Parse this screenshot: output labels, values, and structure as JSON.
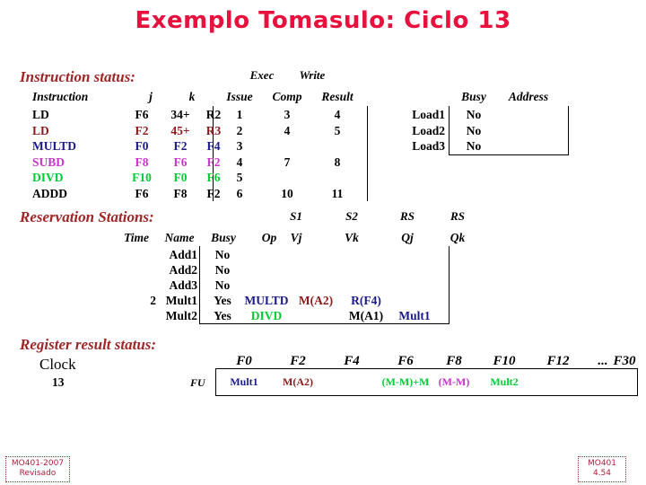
{
  "slide": {
    "title": "Exemplo Tomasulo: Ciclo 13",
    "title_color": "#e8103c"
  },
  "colors": {
    "black": "#000000",
    "red": "#8b1a1a",
    "blue": "#1a1a8b",
    "magenta": "#cc33cc",
    "green": "#00cc33",
    "caption": "#9e2626",
    "footer": "#b01c3c"
  },
  "instruction_status": {
    "caption": "Instruction status:",
    "group_headers": {
      "exec": "Exec",
      "write": "Write"
    },
    "headers": {
      "instruction": "Instruction",
      "j": "j",
      "k": "k",
      "issue": "Issue",
      "comp": "Comp",
      "result": "Result"
    },
    "rows": [
      {
        "instruction": "LD",
        "j": "F6",
        "k": "34+",
        "k2": "R2",
        "issue": "1",
        "comp": "3",
        "result": "4",
        "color": "#000000"
      },
      {
        "instruction": "LD",
        "j": "F2",
        "k": "45+",
        "k2": "R3",
        "issue": "2",
        "comp": "4",
        "result": "5",
        "color": "#8b1a1a"
      },
      {
        "instruction": "MULTD",
        "j": "F0",
        "k": "F2",
        "k2": "F4",
        "issue": "3",
        "comp": "",
        "result": "",
        "color": "#1a1a8b"
      },
      {
        "instruction": "SUBD",
        "j": "F8",
        "k": "F6",
        "k2": "F2",
        "issue": "4",
        "comp": "7",
        "result": "8",
        "color": "#cc33cc"
      },
      {
        "instruction": "DIVD",
        "j": "F10",
        "k": "F0",
        "k2": "F6",
        "issue": "5",
        "comp": "",
        "result": "",
        "color": "#00cc33"
      },
      {
        "instruction": "ADDD",
        "j": "F6",
        "k": "F8",
        "k2": "F2",
        "issue": "6",
        "comp": "10",
        "result": "11",
        "color": "#000000"
      }
    ]
  },
  "load_buffers": {
    "headers": {
      "busy": "Busy",
      "address": "Address"
    },
    "rows": [
      {
        "name": "Load1",
        "busy": "No",
        "address": ""
      },
      {
        "name": "Load2",
        "busy": "No",
        "address": ""
      },
      {
        "name": "Load3",
        "busy": "No",
        "address": ""
      }
    ]
  },
  "reservation_stations": {
    "caption": "Reservation Stations:",
    "group_headers": {
      "s1": "S1",
      "s2": "S2",
      "rs_j": "RS",
      "rs_k": "RS"
    },
    "headers": {
      "time": "Time",
      "name": "Name",
      "busy": "Busy",
      "op": "Op",
      "vj": "Vj",
      "vk": "Vk",
      "qj": "Qj",
      "qk": "Qk"
    },
    "rows": [
      {
        "time": "",
        "name": "Add1",
        "busy": "No",
        "op": "",
        "op_color": "#000000",
        "vj": "",
        "vj_color": "#000000",
        "vk": "",
        "vk_color": "#000000",
        "qj": "",
        "qj_color": "#000000",
        "qk": ""
      },
      {
        "time": "",
        "name": "Add2",
        "busy": "No",
        "op": "",
        "op_color": "#000000",
        "vj": "",
        "vj_color": "#000000",
        "vk": "",
        "vk_color": "#000000",
        "qj": "",
        "qj_color": "#000000",
        "qk": ""
      },
      {
        "time": "",
        "name": "Add3",
        "busy": "No",
        "op": "",
        "op_color": "#000000",
        "vj": "",
        "vj_color": "#000000",
        "vk": "",
        "vk_color": "#000000",
        "qj": "",
        "qj_color": "#000000",
        "qk": ""
      },
      {
        "time": "2",
        "name": "Mult1",
        "busy": "Yes",
        "op": "MULTD",
        "op_color": "#1a1a8b",
        "vj": "M(A2)",
        "vj_color": "#8b1a1a",
        "vk": "R(F4)",
        "vk_color": "#1a1a8b",
        "qj": "",
        "qj_color": "#000000",
        "qk": ""
      },
      {
        "time": "",
        "name": "Mult2",
        "busy": "Yes",
        "op": "DIVD",
        "op_color": "#00cc33",
        "vj": "",
        "vj_color": "#000000",
        "vk": "M(A1)",
        "vk_color": "#000000",
        "qj": "Mult1",
        "qj_color": "#1a1a8b",
        "qk": ""
      }
    ]
  },
  "register_result_status": {
    "caption": "Register result status:",
    "clock_label": "Clock",
    "clock_value": "13",
    "fu_label": "FU",
    "registers": [
      "F0",
      "F2",
      "F4",
      "F6",
      "F8",
      "F10",
      "F12",
      "...",
      "F30"
    ],
    "values": [
      {
        "reg": "F0",
        "value": "Mult1",
        "color": "#1a1a8b"
      },
      {
        "reg": "F2",
        "value": "M(A2)",
        "color": "#8b1a1a"
      },
      {
        "reg": "F4",
        "value": "",
        "color": "#000000"
      },
      {
        "reg": "F6",
        "value": "(M-M)+M",
        "color": "#00cc33"
      },
      {
        "reg": "F8",
        "value": "(M-M)",
        "color": "#cc33cc"
      },
      {
        "reg": "F10",
        "value": "Mult2",
        "color": "#00cc33"
      },
      {
        "reg": "F12",
        "value": "",
        "color": "#000000"
      },
      {
        "reg": "...",
        "value": "",
        "color": "#000000"
      },
      {
        "reg": "F30",
        "value": "",
        "color": "#000000"
      }
    ]
  },
  "footer": {
    "left_line1": "MO401-2007",
    "left_line2": "Revisado",
    "right_line1": "MO401",
    "right_line2": "4.54"
  }
}
